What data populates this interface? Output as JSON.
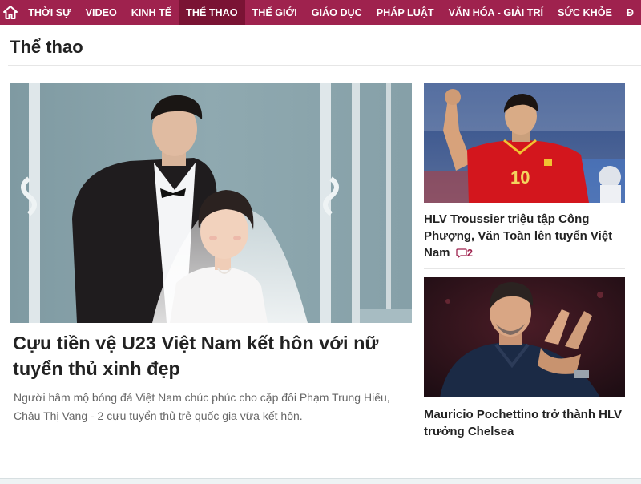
{
  "nav": {
    "home_icon": "home-icon",
    "items": [
      {
        "label": "THỜI SỰ"
      },
      {
        "label": "VIDEO"
      },
      {
        "label": "KINH TẾ"
      },
      {
        "label": "THỂ THAO"
      },
      {
        "label": "THẾ GIỚI"
      },
      {
        "label": "GIÁO DỤC"
      },
      {
        "label": "PHÁP LUẬT"
      },
      {
        "label": "VĂN HÓA - GIẢI TRÍ"
      },
      {
        "label": "SỨC KHỎE"
      },
      {
        "label": "Đ"
      }
    ],
    "active": "THỂ THAO",
    "brand_color": "#9f224e"
  },
  "section": {
    "title": "Thể thao"
  },
  "main_story": {
    "headline": "Cựu tiền vệ U23 Việt Nam kết hôn với nữ tuyển thủ xinh đẹp",
    "summary": "Người hâm mộ bóng đá Việt Nam chúc phúc cho cặp đôi Phạm Trung Hiếu, Châu Thị Vang - 2 cựu tuyển thủ trẻ quốc gia vừa kết hôn."
  },
  "side_stories": [
    {
      "headline": "HLV Troussier triệu tập Công Phượng, Văn Toàn lên tuyển Việt Nam",
      "comment_icon": "comment-icon",
      "comments": "2",
      "jersey_number": "10"
    },
    {
      "headline": "Mauricio Pochettino trở thành HLV trưởng Chelsea"
    }
  ]
}
